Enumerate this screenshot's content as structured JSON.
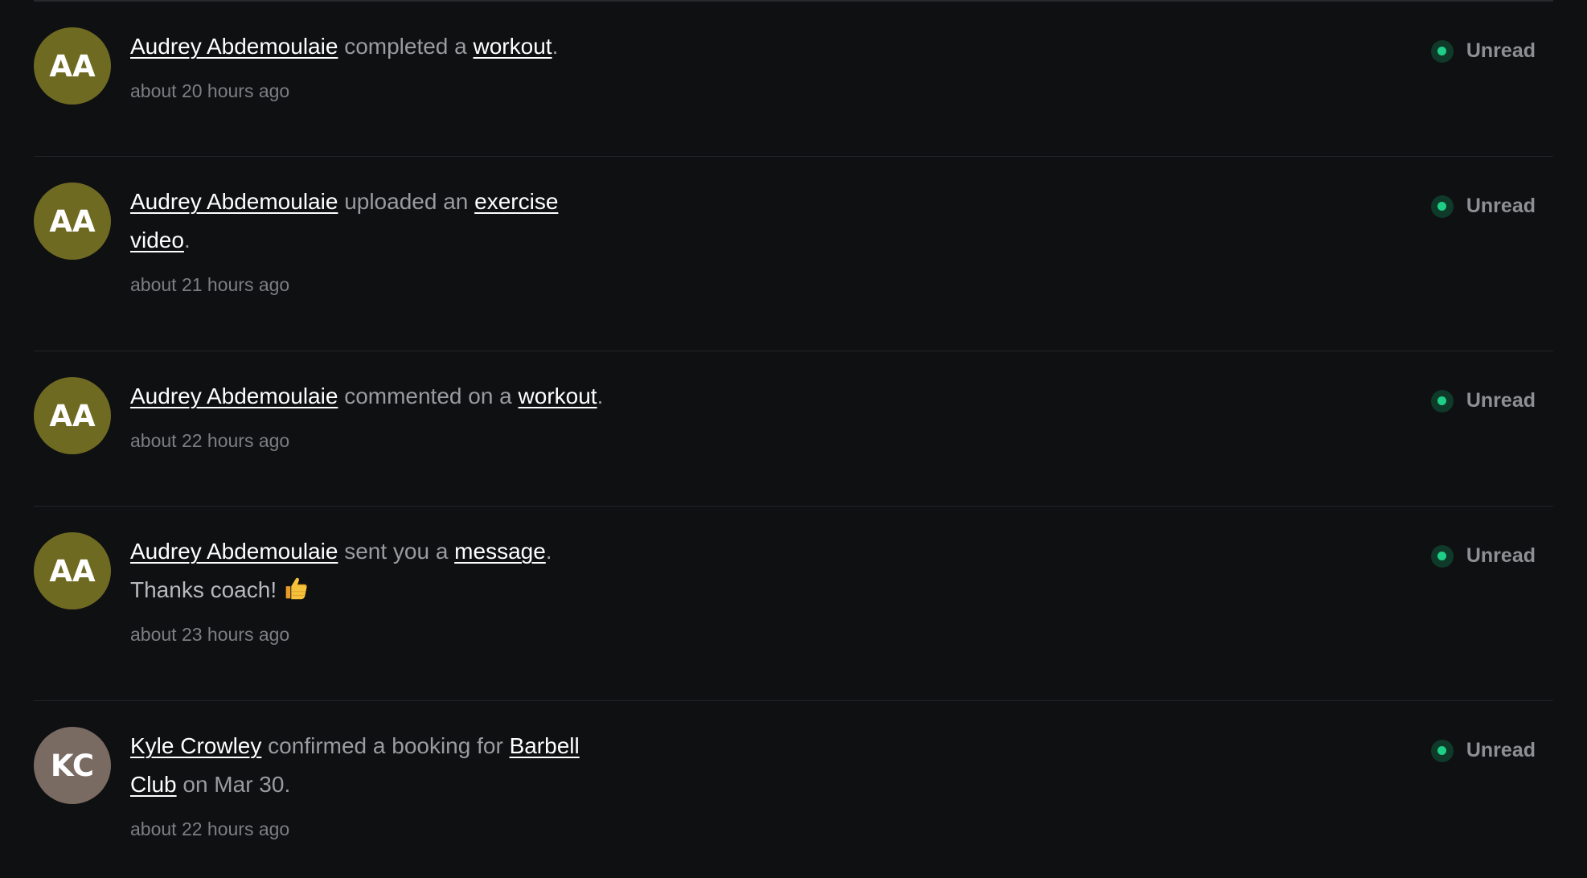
{
  "notifications": [
    {
      "avatar_initials": "AA",
      "actor": "Audrey Abdemoulaie",
      "verb": "completed a",
      "object": "workout",
      "tail": ".",
      "time": "about 20 hours ago",
      "status": "Unread"
    },
    {
      "avatar_initials": "AA",
      "actor": "Audrey Abdemoulaie",
      "verb": "uploaded an",
      "object": "exercise video",
      "tail": ".",
      "time": "about 21 hours ago",
      "status": "Unread"
    },
    {
      "avatar_initials": "AA",
      "actor": "Audrey Abdemoulaie",
      "verb": "commented on a",
      "object": "workout",
      "tail": ".",
      "time": "about 22 hours ago",
      "status": "Unread"
    },
    {
      "avatar_initials": "AA",
      "actor": "Audrey Abdemoulaie",
      "verb": "sent you a",
      "object": "message",
      "tail": ".",
      "body": "Thanks coach!",
      "body_icon": "thumbs-up-icon",
      "time": "about 23 hours ago",
      "status": "Unread"
    },
    {
      "avatar_initials": "KC",
      "actor": "Kyle Crowley",
      "verb": "confirmed a booking for",
      "object": "Barbell Club",
      "tail": "on Mar 30.",
      "time": "about 22 hours ago",
      "status": "Unread"
    }
  ],
  "colors": {
    "background": "#0f1012",
    "avatar_olive": "#6f6a22",
    "avatar_mauve": "#7a6b62",
    "unread_dot": "#1fce86"
  }
}
